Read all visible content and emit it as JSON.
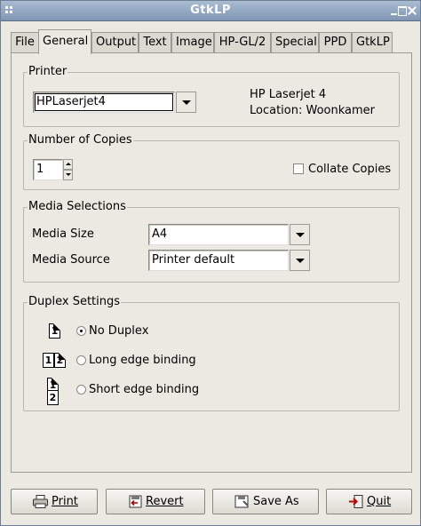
{
  "window": {
    "title": "GtkLP"
  },
  "tabs": [
    {
      "label": "File"
    },
    {
      "label": "General"
    },
    {
      "label": "Output"
    },
    {
      "label": "Text"
    },
    {
      "label": "Image"
    },
    {
      "label": "HP-GL/2"
    },
    {
      "label": "Special"
    },
    {
      "label": "PPD"
    },
    {
      "label": "GtkLP"
    }
  ],
  "active_tab": "General",
  "printer": {
    "frame_label": "Printer",
    "selected": "HPLaserjet4",
    "model": "HP Laserjet 4",
    "location": "Location: Woonkamer"
  },
  "copies": {
    "frame_label": "Number of Copies",
    "value": "1",
    "collate_label": "Collate Copies",
    "collate_checked": false
  },
  "media": {
    "frame_label": "Media Selections",
    "size_label": "Media Size",
    "size_value": "A4",
    "source_label": "Media Source",
    "source_value": "Printer default"
  },
  "duplex": {
    "frame_label": "Duplex Settings",
    "options": [
      {
        "label": "No Duplex",
        "checked": true,
        "icon": "one-page-icon",
        "glyph": "1"
      },
      {
        "label": "Long edge binding",
        "checked": false,
        "icon": "long-edge-icon",
        "glyph": "1 2"
      },
      {
        "label": "Short edge binding",
        "checked": false,
        "icon": "short-edge-icon",
        "glyph": "1 2"
      }
    ]
  },
  "buttons": {
    "print": {
      "label": "Print",
      "icon": "printer-icon"
    },
    "revert": {
      "label": "Revert",
      "icon": "revert-icon"
    },
    "save_as": {
      "label": "Save As",
      "icon": "save-icon"
    },
    "quit": {
      "label": "Quit",
      "icon": "exit-icon"
    }
  }
}
